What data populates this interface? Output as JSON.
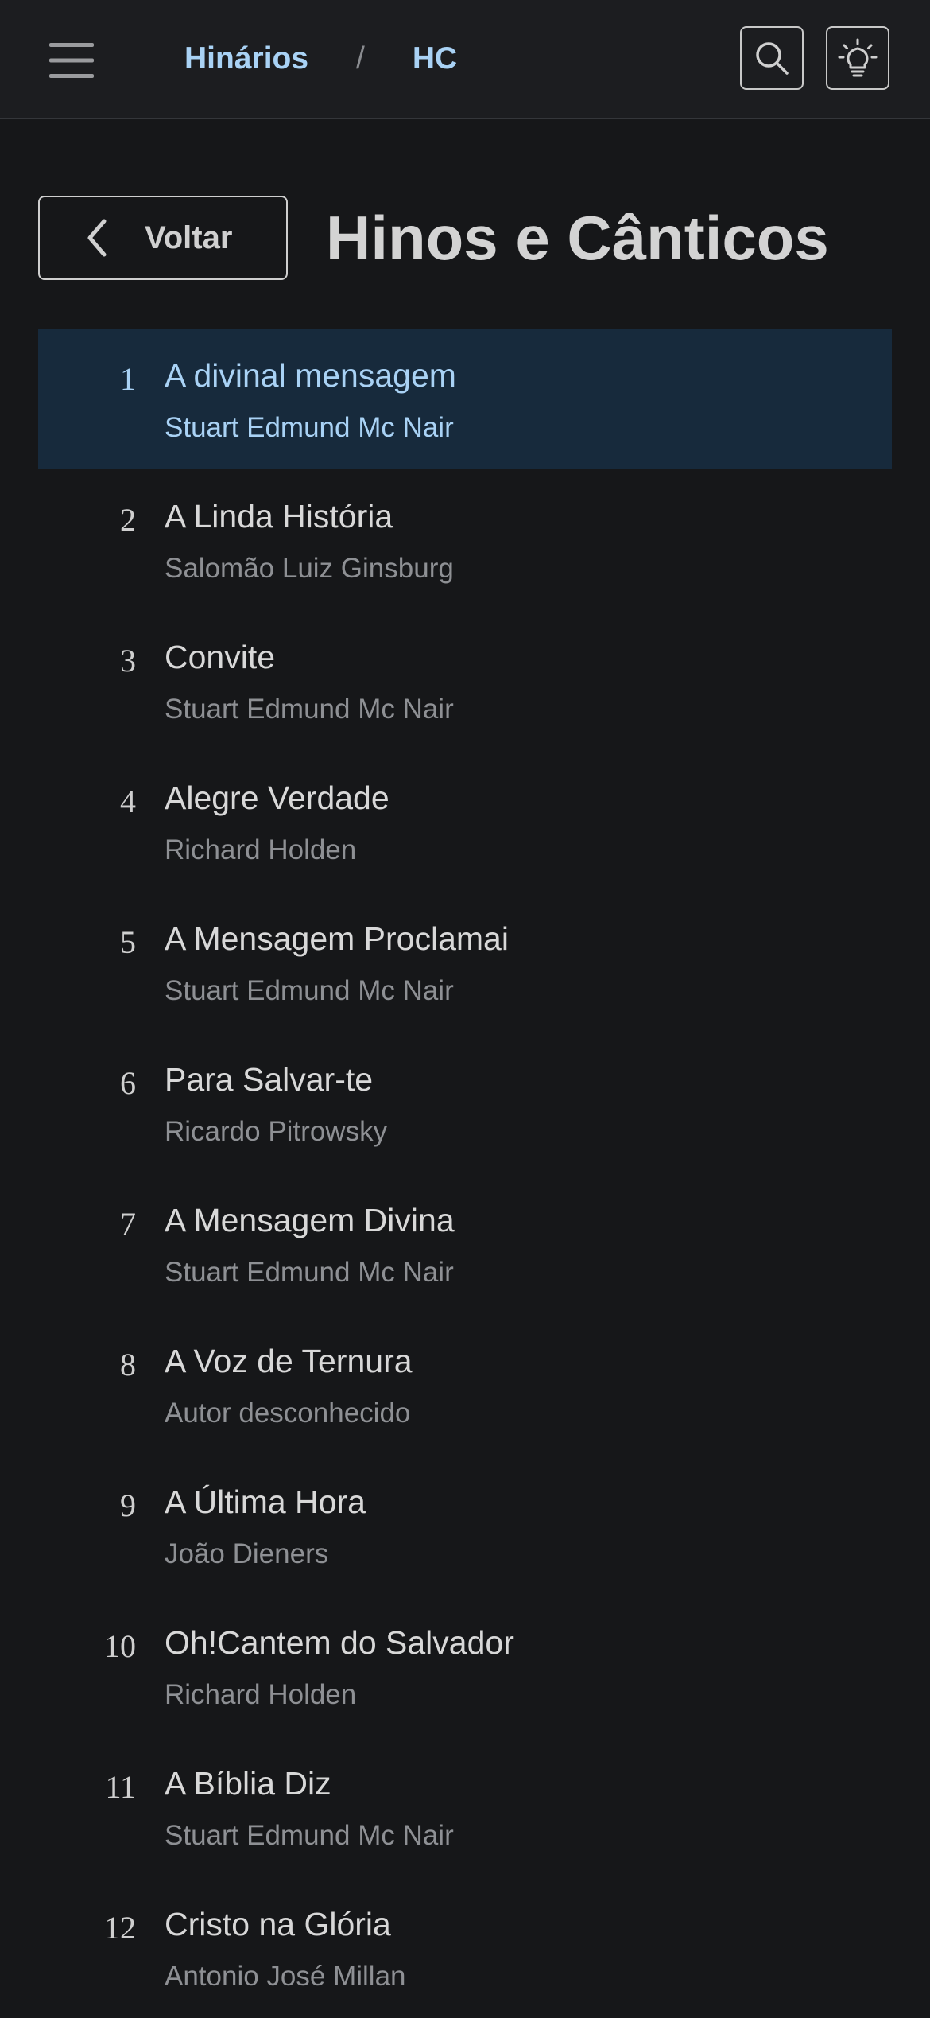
{
  "topbar": {
    "menu_icon": "hamburger-menu-icon",
    "breadcrumb": {
      "root": "Hinários",
      "separator": "/",
      "current": "HC"
    },
    "search_icon": "search-icon",
    "theme_icon": "lightbulb-icon"
  },
  "header": {
    "back_label": "Voltar",
    "back_icon": "chevron-left-icon",
    "title": "Hinos e Cânticos"
  },
  "colors": {
    "background": "#161719",
    "topbar": "#1c1d20",
    "accent": "#a9d2f5",
    "active_row": "#172a3c"
  },
  "hymns": [
    {
      "number": "1",
      "title": "A divinal mensagem",
      "author": "Stuart Edmund Mc Nair",
      "active": true
    },
    {
      "number": "2",
      "title": "A Linda História",
      "author": "Salomão Luiz Ginsburg"
    },
    {
      "number": "3",
      "title": "Convite",
      "author": "Stuart Edmund Mc Nair"
    },
    {
      "number": "4",
      "title": "Alegre Verdade",
      "author": "Richard Holden"
    },
    {
      "number": "5",
      "title": "A Mensagem Proclamai",
      "author": "Stuart Edmund Mc Nair"
    },
    {
      "number": "6",
      "title": "Para Salvar-te",
      "author": "Ricardo Pitrowsky"
    },
    {
      "number": "7",
      "title": "A Mensagem Divina",
      "author": "Stuart Edmund Mc Nair"
    },
    {
      "number": "8",
      "title": "A Voz de Ternura",
      "author": "Autor desconhecido"
    },
    {
      "number": "9",
      "title": "A Última Hora",
      "author": "João Dieners"
    },
    {
      "number": "10",
      "title": "Oh!Cantem do Salvador",
      "author": "Richard Holden"
    },
    {
      "number": "11",
      "title": "A Bíblia Diz",
      "author": "Stuart Edmund Mc Nair"
    },
    {
      "number": "12",
      "title": "Cristo na Glória",
      "author": "Antonio José Millan"
    }
  ]
}
